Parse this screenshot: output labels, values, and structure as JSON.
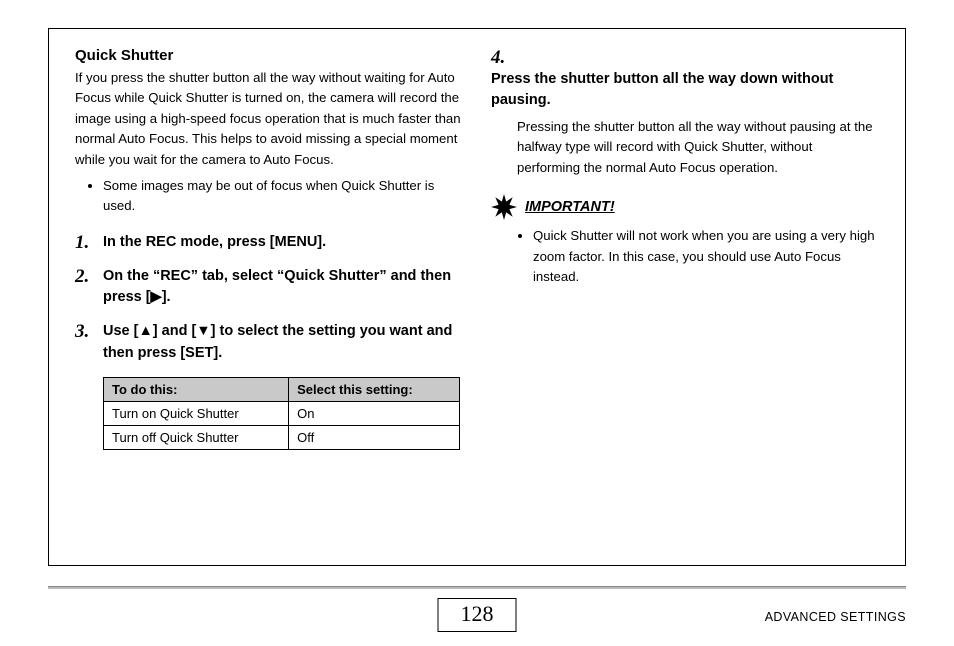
{
  "left": {
    "title": "Quick Shutter",
    "intro": "If you press the shutter button all the way without waiting for Auto Focus while Quick Shutter is turned on, the camera will record the image using a high-speed focus operation that is much faster than normal Auto Focus. This helps to avoid missing a special moment while you wait for the camera to Auto Focus.",
    "bullet1": "Some images may be out of focus when Quick Shutter is used.",
    "step1": "In the REC mode, press [MENU].",
    "step2": "On the “REC” tab, select “Quick Shutter” and then press [▶].",
    "step3": "Use [▲] and [▼] to select the setting you want and then press [SET].",
    "table": {
      "h1": "To do this:",
      "h2": "Select this setting:",
      "r1c1": "Turn on Quick Shutter",
      "r1c2": "On",
      "r2c1": "Turn off Quick Shutter",
      "r2c2": "Off"
    }
  },
  "right": {
    "step4num": "4.",
    "step4": "Press the shutter button all the way down without pausing.",
    "step4desc": "Pressing the shutter button all the way without pausing at the halfway type will record with Quick Shutter, without performing the normal Auto Focus operation.",
    "important_label": "IMPORTANT!",
    "important_bullet": "Quick Shutter will not work when you are using a very high zoom factor. In this case, you should use Auto Focus instead."
  },
  "footer": {
    "page": "128",
    "section": "ADVANCED SETTINGS"
  }
}
